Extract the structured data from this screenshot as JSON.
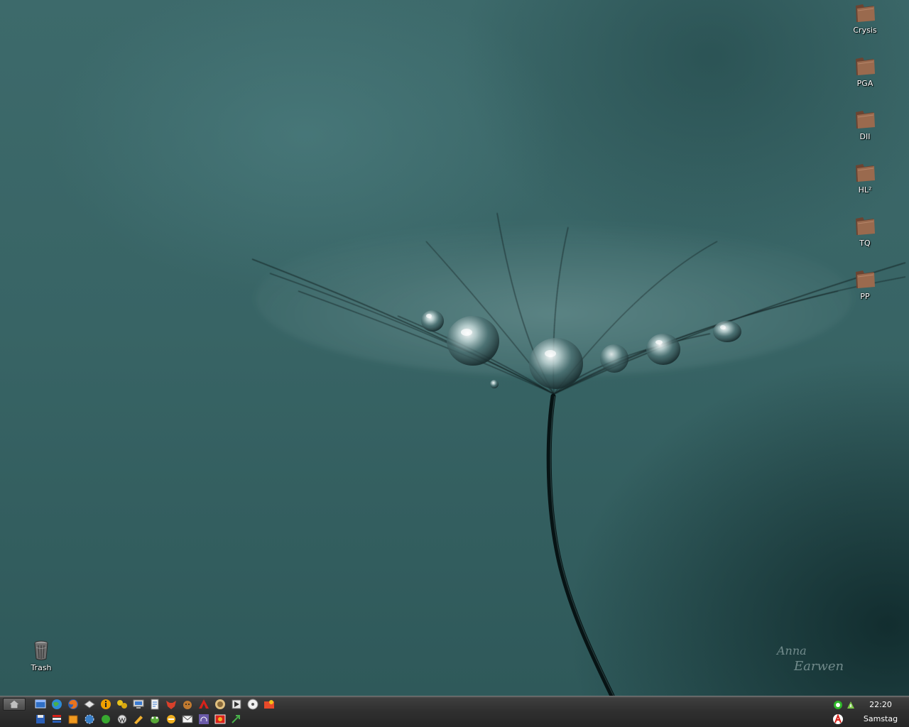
{
  "desktop": {
    "icons": [
      {
        "label": "Crysis",
        "icon": "folder-icon"
      },
      {
        "label": "PGA",
        "icon": "folder-icon"
      },
      {
        "label": "DII",
        "icon": "folder-icon"
      },
      {
        "label": "HL²",
        "icon": "folder-icon"
      },
      {
        "label": "TQ",
        "icon": "folder-icon"
      },
      {
        "label": "PP",
        "icon": "folder-icon"
      }
    ],
    "trash": {
      "label": "Trash",
      "icon": "trash-icon"
    },
    "wallpaper": {
      "signature": "Anna Earwen",
      "subject": "dandelion-seed-with-water-drops"
    }
  },
  "taskbar": {
    "start_icon": "home-icon",
    "quicklaunch_top": [
      "show-desktop-icon",
      "globe-icon",
      "firefox-icon",
      "mail-icon",
      "info-icon",
      "tools-icon",
      "monitor-icon",
      "notepad-icon",
      "fox-icon",
      "dog-icon",
      "adobe-icon",
      "photo-icon",
      "media-icon",
      "disc-icon",
      "paint-icon"
    ],
    "quicklaunch_bottom": [
      "save-icon",
      "flag-icon",
      "box-icon",
      "gear-icon",
      "green-circle-icon",
      "wordpress-icon",
      "pencil-icon",
      "frog-icon",
      "chat-icon",
      "mail-card-icon",
      "headphones-icon",
      "gallery-icon",
      "arrow-icon"
    ],
    "tray": {
      "icons": [
        "network-icon",
        "update-icon",
        "antivirus-icon"
      ],
      "clock_time": "22:20",
      "clock_day": "Samstag"
    }
  },
  "colors": {
    "wallpaper_base": "#386465",
    "taskbar": "#2f2f2f",
    "folder_fill": "#8a5c44",
    "label_text": "#ffffff"
  }
}
